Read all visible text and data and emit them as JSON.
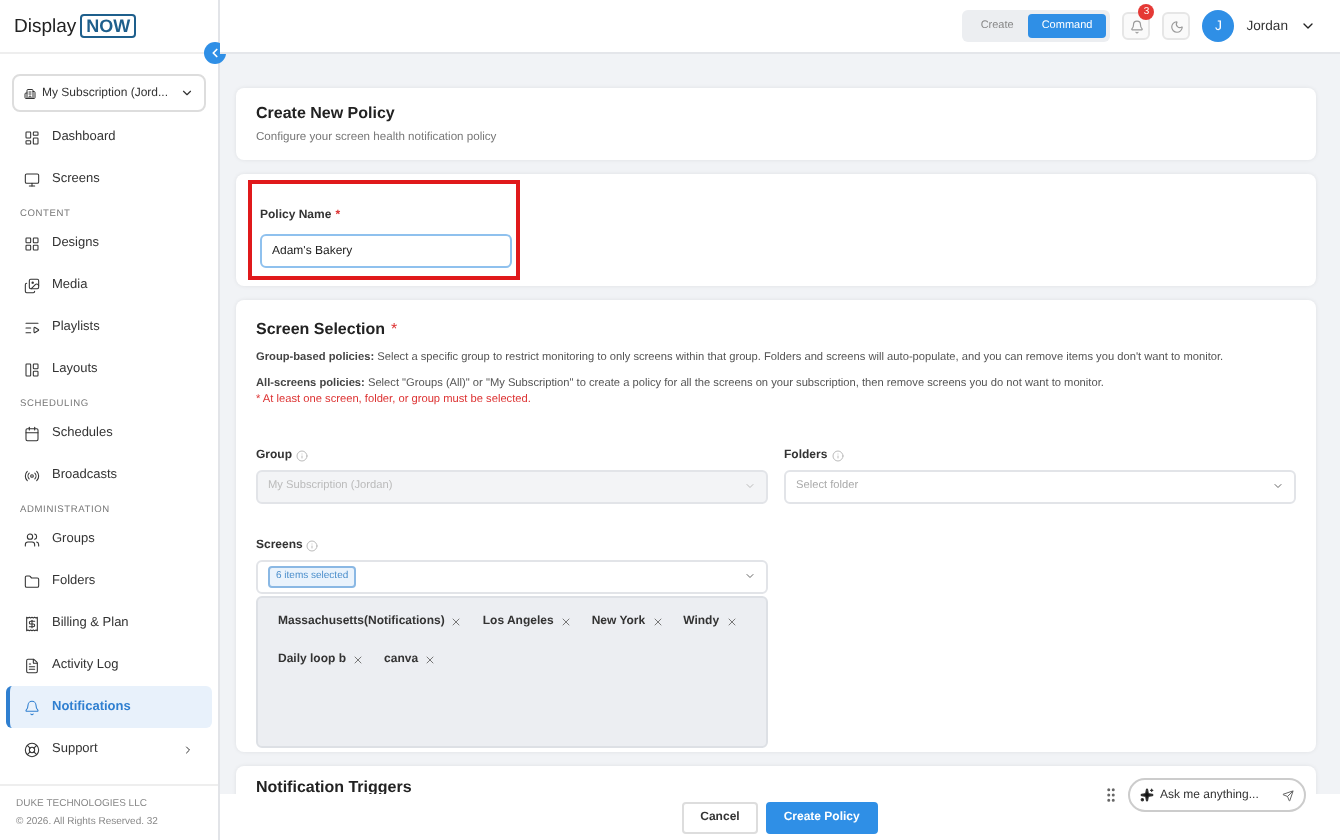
{
  "logo": {
    "word": "Display",
    "badge": "NOW"
  },
  "subscription": {
    "label": "My Subscription (Jord..."
  },
  "nav": [
    {
      "kind": "item",
      "label": "Dashboard",
      "selected": false
    },
    {
      "kind": "item",
      "label": "Screens",
      "selected": false
    },
    {
      "kind": "section",
      "label": "CONTENT"
    },
    {
      "kind": "item",
      "label": "Designs",
      "selected": false
    },
    {
      "kind": "item",
      "label": "Media",
      "selected": false
    },
    {
      "kind": "item",
      "label": "Playlists",
      "selected": false
    },
    {
      "kind": "item",
      "label": "Layouts",
      "selected": false
    },
    {
      "kind": "section",
      "label": "SCHEDULING"
    },
    {
      "kind": "item",
      "label": "Schedules",
      "selected": false
    },
    {
      "kind": "item",
      "label": "Broadcasts",
      "selected": false
    },
    {
      "kind": "section",
      "label": "ADMINISTRATION"
    },
    {
      "kind": "item",
      "label": "Groups",
      "selected": false
    },
    {
      "kind": "item",
      "label": "Folders",
      "selected": false
    },
    {
      "kind": "item",
      "label": "Billing & Plan",
      "selected": false
    },
    {
      "kind": "item",
      "label": "Activity Log",
      "selected": false
    },
    {
      "kind": "item",
      "label": "Notifications",
      "selected": true
    },
    {
      "kind": "item",
      "label": "Support",
      "selected": false,
      "submenu": true
    }
  ],
  "footer": [
    "DUKE TECHNOLOGIES LLC",
    "© 2026. All Rights Reserved. 32"
  ],
  "mode_toggle": [
    {
      "label": "Create",
      "selected": false
    },
    {
      "label": "Command",
      "selected": true
    }
  ],
  "notification_count": "3",
  "user": {
    "initial": "J",
    "name": "Jordan"
  },
  "header": {
    "title": "Create New Policy",
    "subtitle": "Configure your screen health notification policy"
  },
  "policy_name": {
    "label": "Policy Name",
    "required_mark": "*",
    "value": "Adam's Bakery",
    "highlighted": true
  },
  "screen_selection": {
    "title": "Screen Selection",
    "required_mark": "*",
    "notes": [
      "**Group-based policies:** Select a specific group to restrict monitoring to only screens within that group. Folders and screens will auto-populate, and you can remove items you don't want to monitor.",
      "**All-screens policies:** Select \"Groups (All)\" or \"My Subscription\" to create a policy for all the screens on your subscription, then remove screens you do not want to monitor."
    ],
    "warning": "* At least one screen, folder, or group must be selected.",
    "group": {
      "label": "Group",
      "value": "My Subscription (Jordan)",
      "disabled": true
    },
    "folders": {
      "label": "Folders",
      "placeholder": "Select folder"
    },
    "screens": {
      "label": "Screens",
      "summary": "6 items selected",
      "tags": [
        "Massachusetts(Notifications)",
        "Los Angeles",
        "New York",
        "Windy",
        "Daily loop b",
        "canva"
      ]
    }
  },
  "next_section": {
    "title": "Notification Triggers"
  },
  "actions": [
    {
      "label": "Cancel",
      "kind": "secondary"
    },
    {
      "label": "Create Policy",
      "kind": "primary"
    }
  ],
  "assistant": {
    "placeholder": "Ask me anything..."
  }
}
